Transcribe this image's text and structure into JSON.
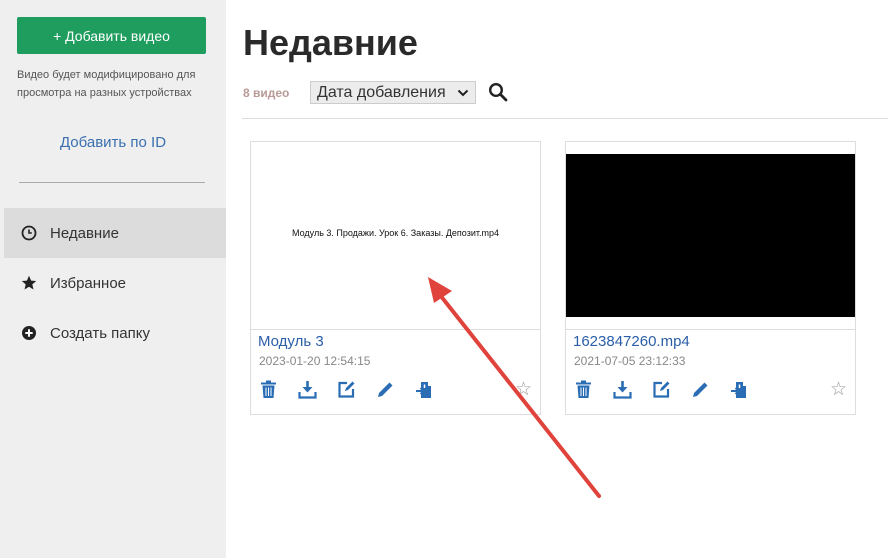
{
  "sidebar": {
    "add_video": "+ Добавить видео",
    "hint": "Видео будет модифицировано для просмотра на разных устройствах",
    "add_by_id": "Добавить по ID",
    "nav": [
      {
        "label": "Недавние",
        "icon": "clock-icon",
        "active": true
      },
      {
        "label": "Избранное",
        "icon": "star-icon",
        "active": false
      },
      {
        "label": "Создать папку",
        "icon": "plus-circle-icon",
        "active": false
      }
    ]
  },
  "main": {
    "title": "Недавние",
    "count": "8 видео",
    "sort": {
      "selected": "Дата добавления"
    },
    "videos": [
      {
        "title": "Модуль 3",
        "date": "2023-01-20 12:54:15",
        "thumb_text": "Модуль 3. Продажи. Урок 6. Заказы. Депозит.mp4",
        "thumb": "white"
      },
      {
        "title": "1623847260.mp4",
        "date": "2021-07-05 23:12:33",
        "thumb_text": "",
        "thumb": "black"
      }
    ]
  },
  "colors": {
    "accent": "#1f9d5e",
    "link": "#2a5ea8",
    "icon": "#2a6db5",
    "arrow": "#e0433b"
  }
}
